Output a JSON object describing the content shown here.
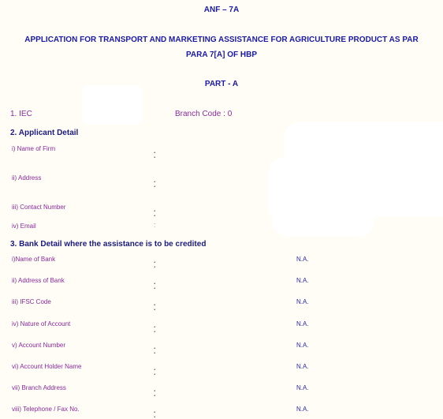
{
  "header": {
    "form_code": "ANF – 7A",
    "title_line1": "APPLICATION FOR TRANSPORT AND MARKETING ASSISTANCE FOR AGRICULTURE PRODUCT AS PAR",
    "title_line2": "PARA 7[A] OF HBP",
    "part": "PART - A"
  },
  "iec": {
    "label": "1. IEC",
    "branch_code": "Branch Code : 0"
  },
  "applicant": {
    "heading": "2. Applicant Detail",
    "fields": [
      {
        "label": "i) Name of Firm",
        "separator": ":"
      },
      {
        "label": "ii) Address",
        "separator": ":"
      },
      {
        "label": "iii) Contact Number",
        "separator": ":"
      },
      {
        "label": "iv) Email",
        "separator": ":"
      }
    ]
  },
  "bank": {
    "heading": "3. Bank Detail where the assistance is to be credited",
    "fields": [
      {
        "label": "i)Name of Bank",
        "separator": ":",
        "value": "N.A."
      },
      {
        "label": "ii) Address of Bank",
        "separator": ":",
        "value": "N.A."
      },
      {
        "label": "iii) IFSC Code",
        "separator": ":",
        "value": "N.A."
      },
      {
        "label": "iv) Nature of Account",
        "separator": ":",
        "value": "N.A."
      },
      {
        "label": "v) Account Number",
        "separator": ":",
        "value": "N.A."
      },
      {
        "label": "vi) Account Holder Name",
        "separator": ":",
        "value": "N.A."
      },
      {
        "label": "vii) Branch Address",
        "separator": ":",
        "value": "N.A."
      },
      {
        "label": "viii) Telephone / Fax No.",
        "separator": ":",
        "value": "N.A."
      }
    ]
  },
  "colors": {
    "heading": "#1a1aa6",
    "label": "#8a2a9e",
    "value": "#2a2ab0",
    "background": "#fffdf5"
  }
}
